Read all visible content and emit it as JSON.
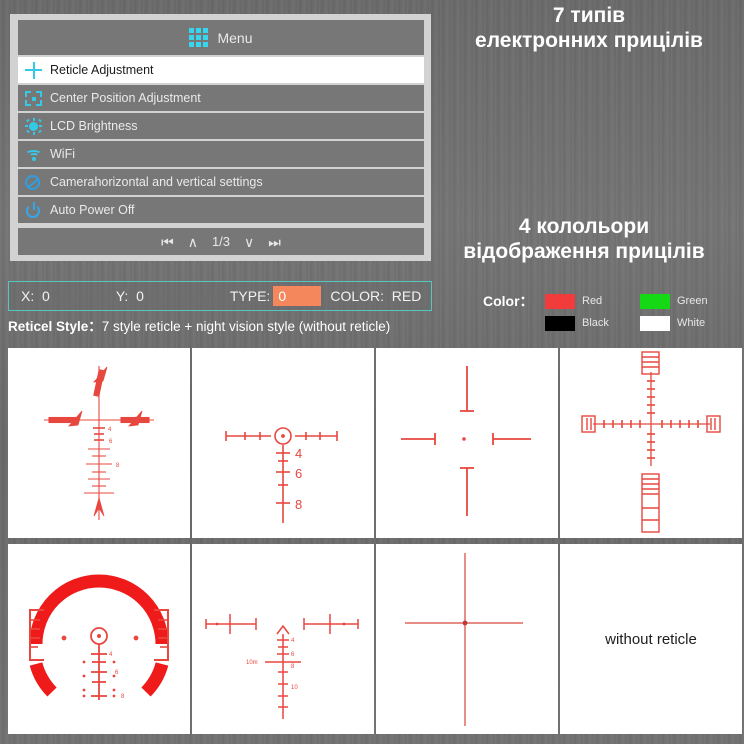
{
  "menu": {
    "header": {
      "title": "Menu",
      "icon": "grid-icon"
    },
    "items": [
      {
        "label": "Reticle Adjustment",
        "icon": "plus-icon",
        "selected": true
      },
      {
        "label": "Center Position Adjustment",
        "icon": "crop-frame-icon",
        "selected": false
      },
      {
        "label": "LCD Brightness",
        "icon": "brightness-icon",
        "selected": false
      },
      {
        "label": "WiFi",
        "icon": "wifi-icon",
        "selected": false
      },
      {
        "label": "Camerahorizontal and vertical settings",
        "icon": "circle-slash-icon",
        "selected": false
      },
      {
        "label": "Auto Power Off",
        "icon": "power-icon",
        "selected": false
      }
    ],
    "pagination": {
      "first": "⏮",
      "prev": "∧",
      "page": "1/3",
      "next": "∨",
      "last": "⏭"
    }
  },
  "status_bar": {
    "x_label": "X:",
    "x_value": "0",
    "y_label": "Y:",
    "y_value": "0",
    "type_label": "TYPE:",
    "type_value": "0",
    "type_highlight_color": "#f4875c",
    "color_label": "COLOR:",
    "color_value": "RED",
    "border_color": "#58c6c0"
  },
  "reticle_style": {
    "label": "Reticel Style：",
    "value": "7 style reticle + night vision style (without reticle)"
  },
  "headlines": {
    "first_line_1": "7 типів",
    "first_line_2": "електронних прицілів",
    "second_line_1": "4 колольори",
    "second_line_2": "відображення прицілів"
  },
  "color_legend": {
    "label": "Color：",
    "swatches": [
      {
        "name": "Red",
        "hex": "#f23b3b"
      },
      {
        "name": "Green",
        "hex": "#16d916"
      },
      {
        "name": "Black",
        "hex": "#000000"
      },
      {
        "name": "White",
        "hex": "#ffffff"
      }
    ]
  },
  "reticles": [
    {
      "id": 1,
      "name": "crosshair-arrow-bdc",
      "labels": [
        "4",
        "6",
        "8"
      ]
    },
    {
      "id": 2,
      "name": "circle-dot-bdc",
      "labels": [
        "4",
        "6",
        "8"
      ]
    },
    {
      "id": 3,
      "name": "german-4-dot",
      "labels": []
    },
    {
      "id": 4,
      "name": "mil-dot-ladder",
      "labels": []
    },
    {
      "id": 5,
      "name": "horseshoe-circle-dot",
      "labels": [
        "4",
        "6",
        "8"
      ]
    },
    {
      "id": 6,
      "name": "chevron-bdc",
      "labels": [
        "4",
        "6",
        "8",
        "10",
        "10m"
      ]
    },
    {
      "id": 7,
      "name": "fine-crosshair-dot",
      "labels": []
    },
    {
      "id": 8,
      "name": "no-reticle",
      "text": "without reticle"
    }
  ],
  "reticle_color": "#e8473f"
}
